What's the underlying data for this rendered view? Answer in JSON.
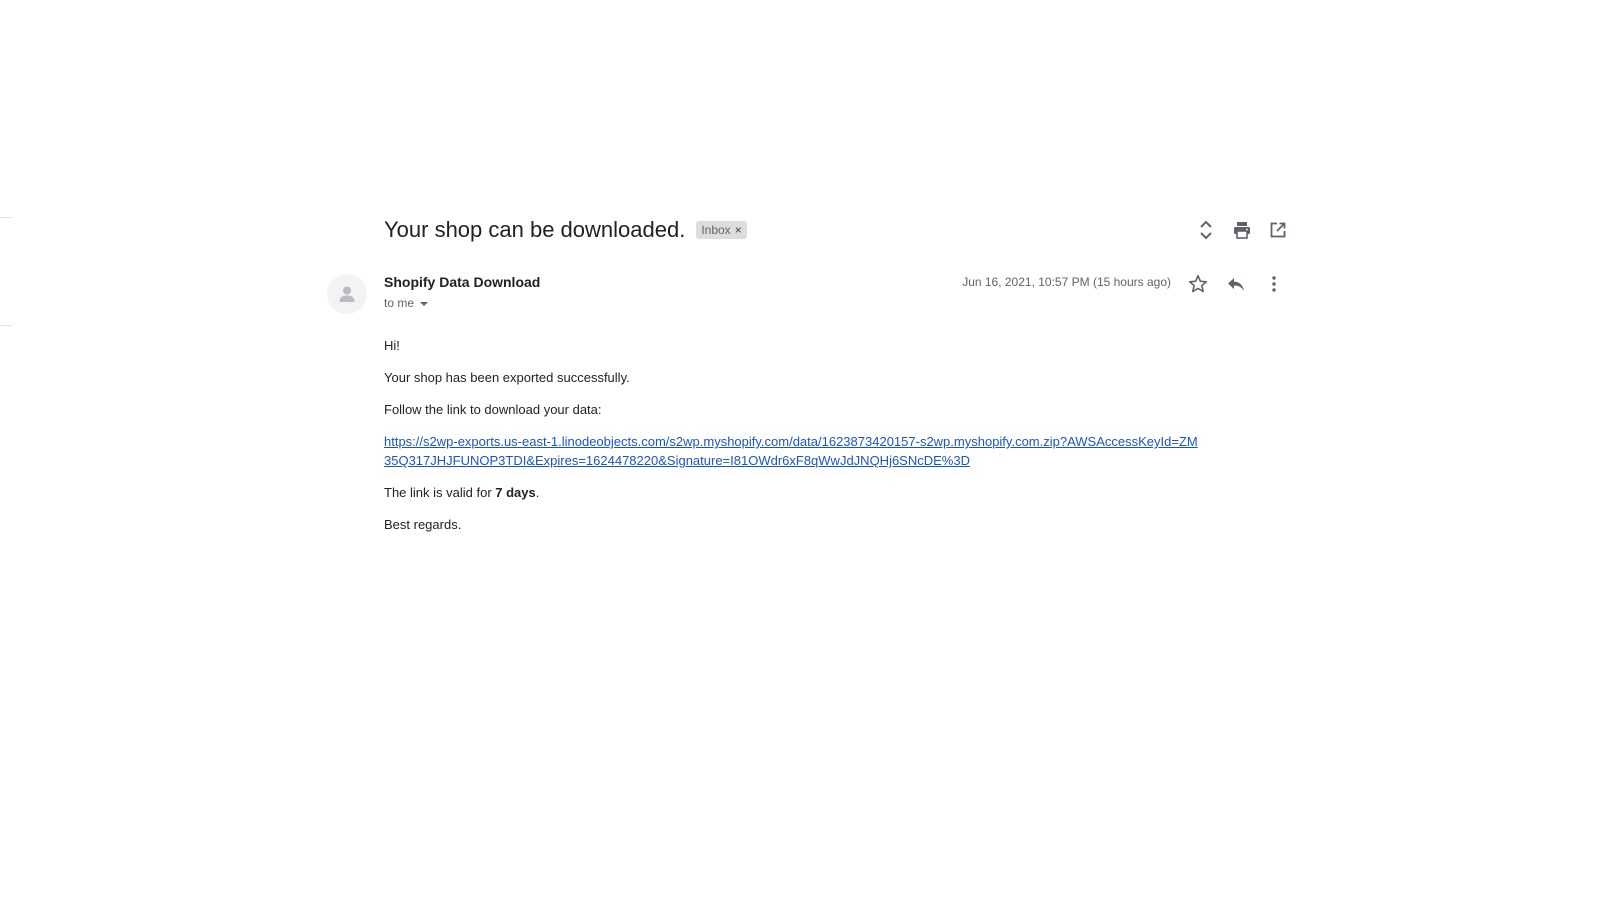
{
  "email": {
    "subject": "Your shop can be downloaded.",
    "label": "Inbox",
    "label_remove": "×",
    "sender_name": "Shopify Data Download",
    "recipient": "to me",
    "date": "Jun 16, 2021, 10:57 PM (15 hours ago)",
    "body": {
      "greeting": "Hi!",
      "line1": "Your shop has been exported successfully.",
      "line2": "Follow the link to download your data:",
      "link": "https://s2wp-exports.us-east-1.linodeobjects.com/s2wp.myshopify.com/data/1623873420157-s2wp.myshopify.com.zip?AWSAccessKeyId=ZM35Q317JHJFUNOP3TDI&Expires=1624478220&Signature=I81OWdr6xF8qWwJdJNQHj6SNcDE%3D",
      "validity_prefix": "The link is valid for ",
      "validity_days": "7 days",
      "validity_suffix": ".",
      "closing": "Best regards."
    }
  },
  "icons": {
    "expand": "unfold-icon",
    "print": "print-icon",
    "open_new": "open-in-new-icon",
    "star": "star-outline-icon",
    "reply": "reply-icon",
    "more": "more-vert-icon",
    "avatar": "person-icon"
  },
  "colors": {
    "link": "#1a55c6",
    "chip_bg": "#dddddd",
    "icon": "#5f6368"
  }
}
